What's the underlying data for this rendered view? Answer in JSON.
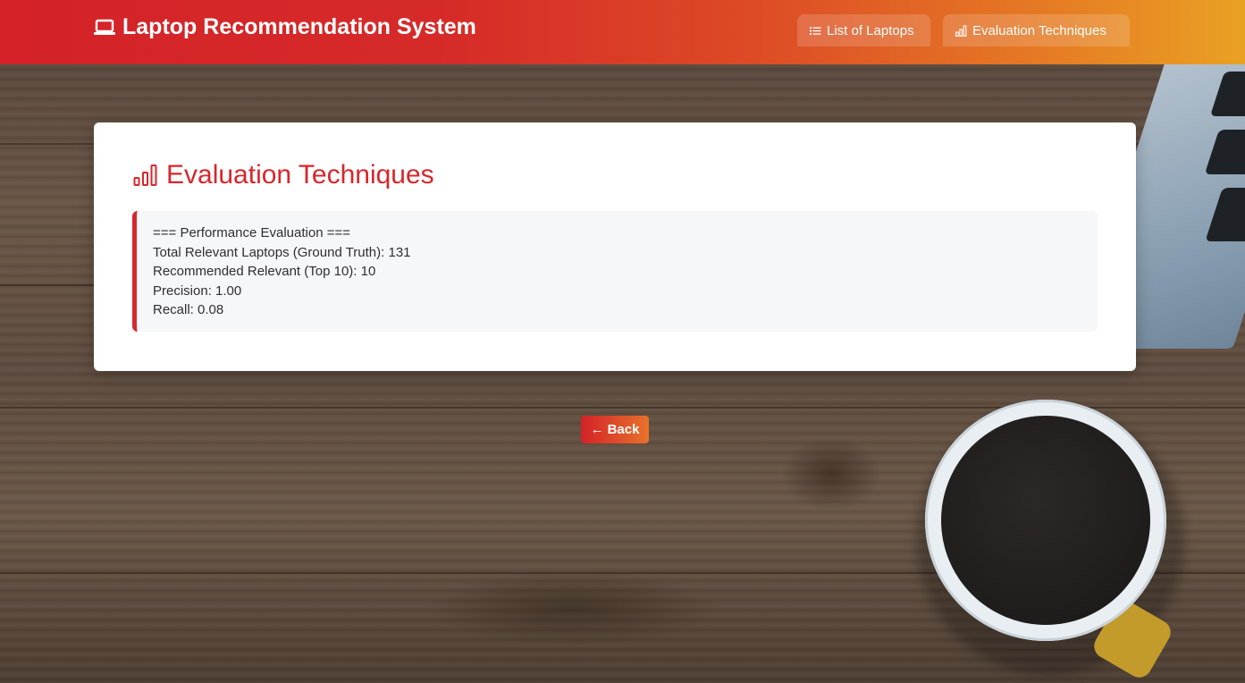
{
  "navbar": {
    "brand_title": "Laptop Recommendation System",
    "brand_icon": "laptop-icon",
    "links": [
      {
        "label": "List of Laptops",
        "icon": "list-icon"
      },
      {
        "label": "Evaluation Techniques",
        "icon": "bar-chart-icon"
      }
    ]
  },
  "card": {
    "title": "Evaluation Techniques",
    "title_icon": "bar-chart-icon",
    "lines": [
      "=== Performance Evaluation ===",
      "Total Relevant Laptops (Ground Truth): 131",
      "Recommended Relevant (Top 10): 10",
      "Precision: 1.00",
      "Recall: 0.08"
    ]
  },
  "back_button": {
    "label": "Back",
    "icon": "arrow-left-icon"
  },
  "colors": {
    "accent_red": "#d8262c",
    "gradient_end_orange": "#e9a123",
    "card_bg": "#ffffff",
    "result_bg": "#f6f7f9"
  }
}
